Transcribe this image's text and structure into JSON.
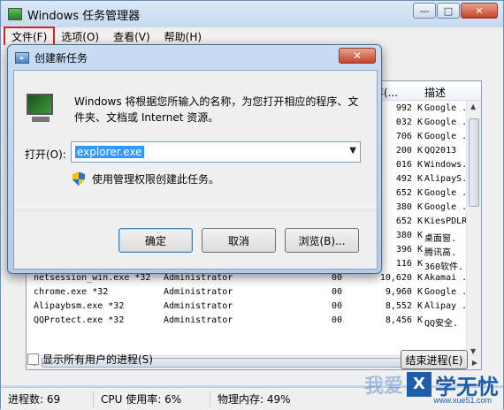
{
  "main_window": {
    "title": "Windows 任务管理器",
    "menu": [
      {
        "label": "文件(F)"
      },
      {
        "label": "选项(O)"
      },
      {
        "label": "查看(V)"
      },
      {
        "label": "帮助(H)"
      }
    ],
    "columns": {
      "mem": "存(...",
      "desc": "描述"
    },
    "rows": [
      {
        "name": "",
        "user": "",
        "cpu": "",
        "mem": "992 K",
        "desc": "Google ."
      },
      {
        "name": "",
        "user": "",
        "cpu": "",
        "mem": "032 K",
        "desc": "Google ."
      },
      {
        "name": "",
        "user": "",
        "cpu": "",
        "mem": "706 K",
        "desc": "Google ."
      },
      {
        "name": "",
        "user": "",
        "cpu": "",
        "mem": "200 K",
        "desc": "QQ2013"
      },
      {
        "name": "",
        "user": "",
        "cpu": "",
        "mem": "016 K",
        "desc": "Windows."
      },
      {
        "name": "",
        "user": "",
        "cpu": "",
        "mem": "492 K",
        "desc": "AlipayS."
      },
      {
        "name": "",
        "user": "",
        "cpu": "",
        "mem": "652 K",
        "desc": "Google ."
      },
      {
        "name": "",
        "user": "",
        "cpu": "",
        "mem": "380 K",
        "desc": "Google ."
      },
      {
        "name": "",
        "user": "",
        "cpu": "",
        "mem": "652 K",
        "desc": "KiesPDLR"
      },
      {
        "name": "",
        "user": "",
        "cpu": "",
        "mem": "380 K",
        "desc": "桌面窗."
      },
      {
        "name": "",
        "user": "",
        "cpu": "",
        "mem": "396 K",
        "desc": "腾讯高."
      },
      {
        "name": "",
        "user": "",
        "cpu": "",
        "mem": "116 K",
        "desc": "360软件."
      },
      {
        "name": "netsession_win.exe *32",
        "user": "Administrator",
        "cpu": "00",
        "mem": "10,620 K",
        "desc": "Akamai ."
      },
      {
        "name": "chrome.exe *32",
        "user": "Administrator",
        "cpu": "00",
        "mem": "9,960 K",
        "desc": "Google ."
      },
      {
        "name": "Alipaybsm.exe *32",
        "user": "Administrator",
        "cpu": "00",
        "mem": "8,552 K",
        "desc": "Alipay ."
      },
      {
        "name": "QQProtect.exe *32",
        "user": "Administrator",
        "cpu": "00",
        "mem": "8,456 K",
        "desc": "QQ安全."
      }
    ],
    "show_all_label": "显示所有用户的进程(S)",
    "end_process_label": "结束进程(E)",
    "status": {
      "processes": "进程数: 69",
      "cpu": "CPU 使用率: 6%",
      "memory": "物理内存: 49%"
    }
  },
  "dialog": {
    "title": "创建新任务",
    "description": "Windows 将根据您所输入的名称，为您打开相应的程序、文件夹、文档或 Internet 资源。",
    "open_label": "打开(O):",
    "open_value": "explorer.exe",
    "admin_label": "使用管理权限创建此任务。",
    "ok_label": "确定",
    "cancel_label": "取消",
    "browse_label": "浏览(B)..."
  },
  "watermark": {
    "faded": "我爱",
    "logo": "X",
    "text": "学无忧",
    "url": "www.xue51.com"
  },
  "accent_colors": {
    "highlight_red": "#e02020",
    "selection_blue": "#3399ff",
    "close_red": "#c7402a"
  }
}
